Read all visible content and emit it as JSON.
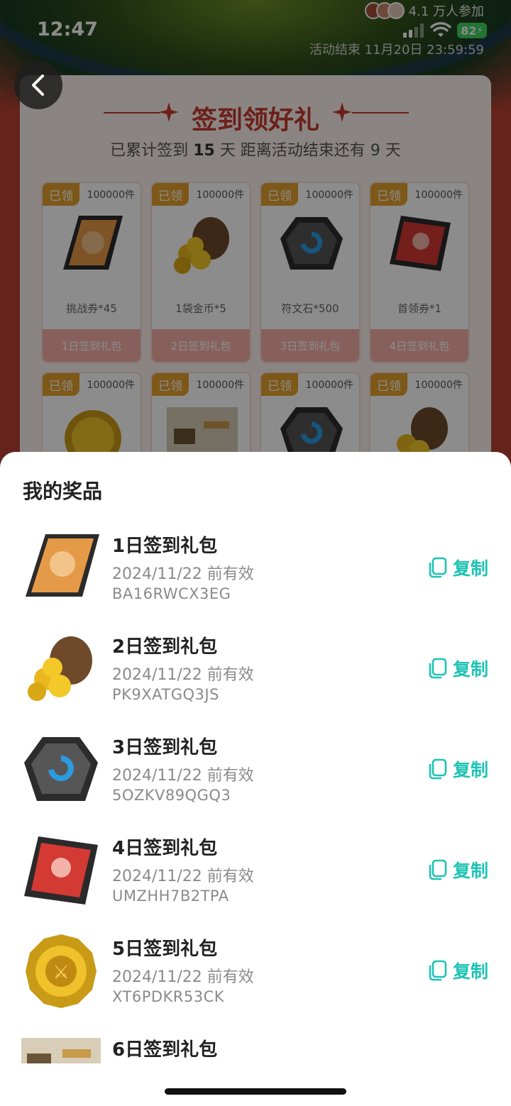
{
  "status_bar": {
    "time": "12:47",
    "battery": "82"
  },
  "event": {
    "participants": "4.1 万人参加",
    "end_time": "活动结束 11月20日 23:59:59"
  },
  "card": {
    "title": "签到领好礼",
    "subtitle_prefix": "已累计签到",
    "signed_days": "15",
    "subtitle_mid": "天  距离活动结束还有",
    "remaining_days": "9",
    "subtitle_suffix": "天"
  },
  "gifts": [
    {
      "tag": "已领",
      "stock": "100000件",
      "name": "挑战券*45",
      "button": "1日签到礼包",
      "icon": "challenge-ticket-icon"
    },
    {
      "tag": "已领",
      "stock": "100000件",
      "name": "1袋金币*5",
      "button": "2日签到礼包",
      "icon": "gold-coin-bag-icon"
    },
    {
      "tag": "已领",
      "stock": "100000件",
      "name": "符文石*500",
      "button": "3日签到礼包",
      "icon": "rune-stone-icon"
    },
    {
      "tag": "已领",
      "stock": "100000件",
      "name": "首领券*1",
      "button": "4日签到礼包",
      "icon": "boss-ticket-icon"
    },
    {
      "tag": "已领",
      "stock": "100000件",
      "icon": "gold-medal-icon"
    },
    {
      "tag": "已领",
      "stock": "100000件",
      "icon": "tools-icon"
    },
    {
      "tag": "已领",
      "stock": "100000件",
      "icon": "rune-stone-icon"
    },
    {
      "tag": "已领",
      "stock": "100000件",
      "icon": "gold-coin-bag-icon"
    }
  ],
  "sheet": {
    "title": "我的奖品",
    "copy_label": "复制",
    "prizes": [
      {
        "name": "1日签到礼包",
        "valid": "2024/11/22 前有效",
        "code": "BA16RWCX3EG",
        "icon": "challenge-ticket-icon"
      },
      {
        "name": "2日签到礼包",
        "valid": "2024/11/22 前有效",
        "code": "PK9XATGQ3JS",
        "icon": "gold-coin-bag-icon"
      },
      {
        "name": "3日签到礼包",
        "valid": "2024/11/22 前有效",
        "code": "5OZKV89QGQ3",
        "icon": "rune-stone-icon"
      },
      {
        "name": "4日签到礼包",
        "valid": "2024/11/22 前有效",
        "code": "UMZHH7B2TPA",
        "icon": "boss-ticket-icon"
      },
      {
        "name": "5日签到礼包",
        "valid": "2024/11/22 前有效",
        "code": "XT6PDKR53CK",
        "icon": "gold-medal-icon"
      },
      {
        "name": "6日签到礼包",
        "icon": "tools-icon"
      }
    ]
  },
  "colors": {
    "accent": "#1fc3b4",
    "title_red": "#c73a2f",
    "tag_orange": "#e4a02c",
    "gift_button": "#f6b0a8"
  }
}
